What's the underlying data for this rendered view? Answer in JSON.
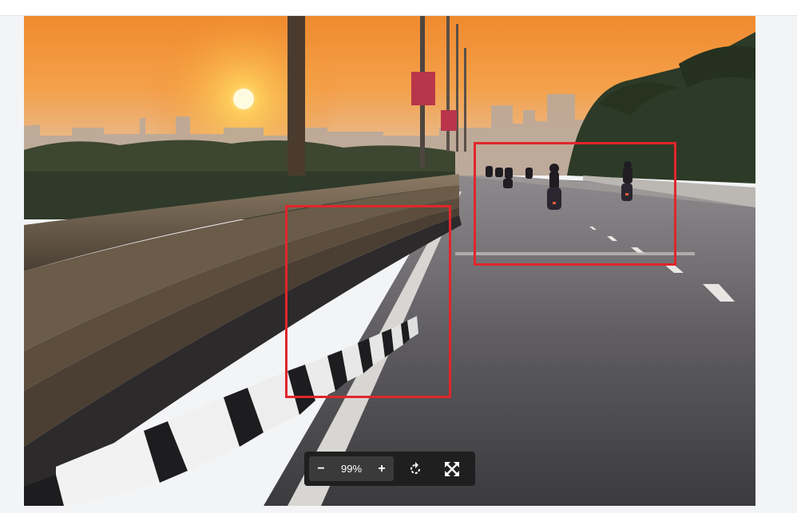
{
  "toolbar": {
    "zoom_out_label": "−",
    "zoom_value": "99%",
    "zoom_in_label": "+"
  },
  "icons": {
    "rotate": "rotate-icon",
    "fullscreen": "fullscreen-icon"
  },
  "colors": {
    "annotation_box": "#e0262b",
    "toolbar_bg": "#1f1f1f"
  }
}
